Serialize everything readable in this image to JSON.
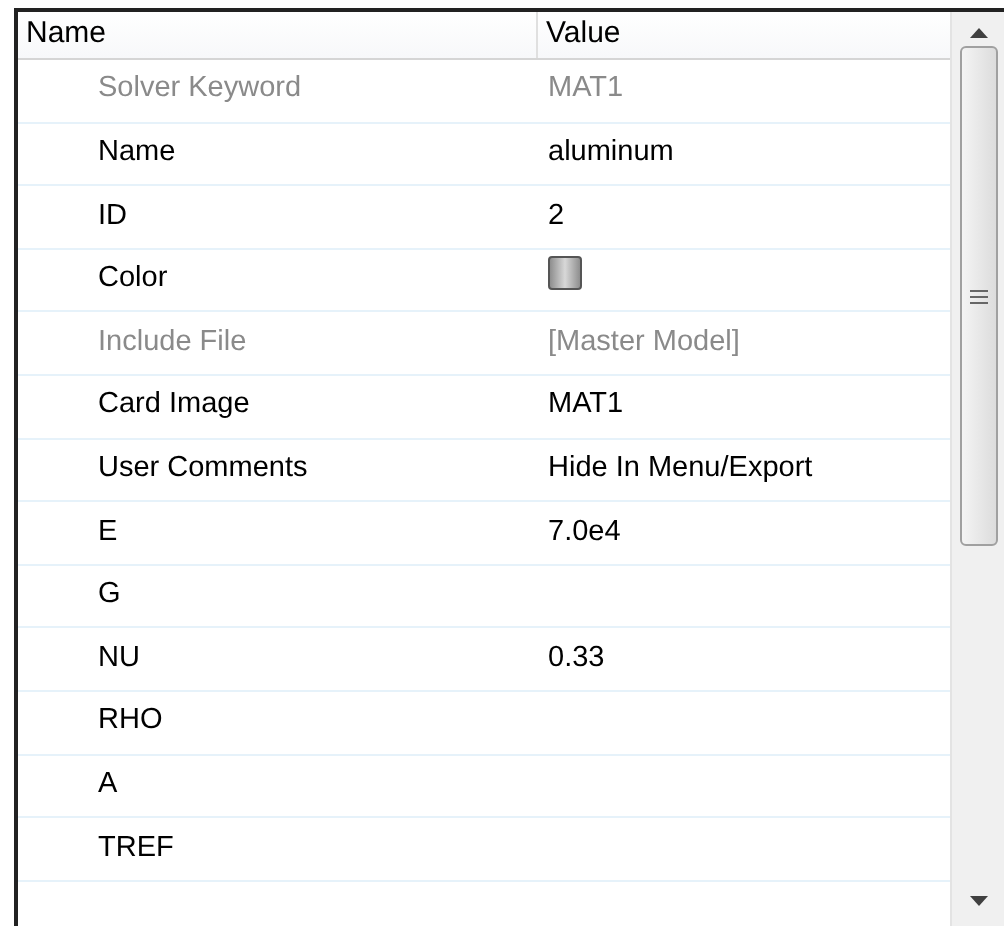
{
  "table": {
    "columns": [
      "Name",
      "Value"
    ],
    "rows": [
      {
        "name": "Solver Keyword",
        "value": "MAT1",
        "disabled": true,
        "kind": "text"
      },
      {
        "name": "Name",
        "value": "aluminum",
        "disabled": false,
        "kind": "text"
      },
      {
        "name": "ID",
        "value": "2",
        "disabled": false,
        "kind": "text"
      },
      {
        "name": "Color",
        "color": "#8e8e8e",
        "disabled": false,
        "kind": "color"
      },
      {
        "name": "Include File",
        "value": "[Master Model]",
        "disabled": true,
        "kind": "text"
      },
      {
        "name": "Card Image",
        "value": "MAT1",
        "disabled": false,
        "kind": "text"
      },
      {
        "name": "User Comments",
        "value": "Hide In Menu/Export",
        "disabled": false,
        "kind": "text"
      },
      {
        "name": "E",
        "value": "7.0e4",
        "disabled": false,
        "kind": "text"
      },
      {
        "name": "G",
        "disabled": false,
        "kind": "text"
      },
      {
        "name": "NU",
        "value": "0.33",
        "disabled": false,
        "kind": "text"
      },
      {
        "name": "RHO",
        "disabled": false,
        "kind": "text"
      },
      {
        "name": "A",
        "disabled": false,
        "kind": "text"
      },
      {
        "name": "TREF",
        "disabled": false,
        "kind": "text"
      }
    ]
  }
}
